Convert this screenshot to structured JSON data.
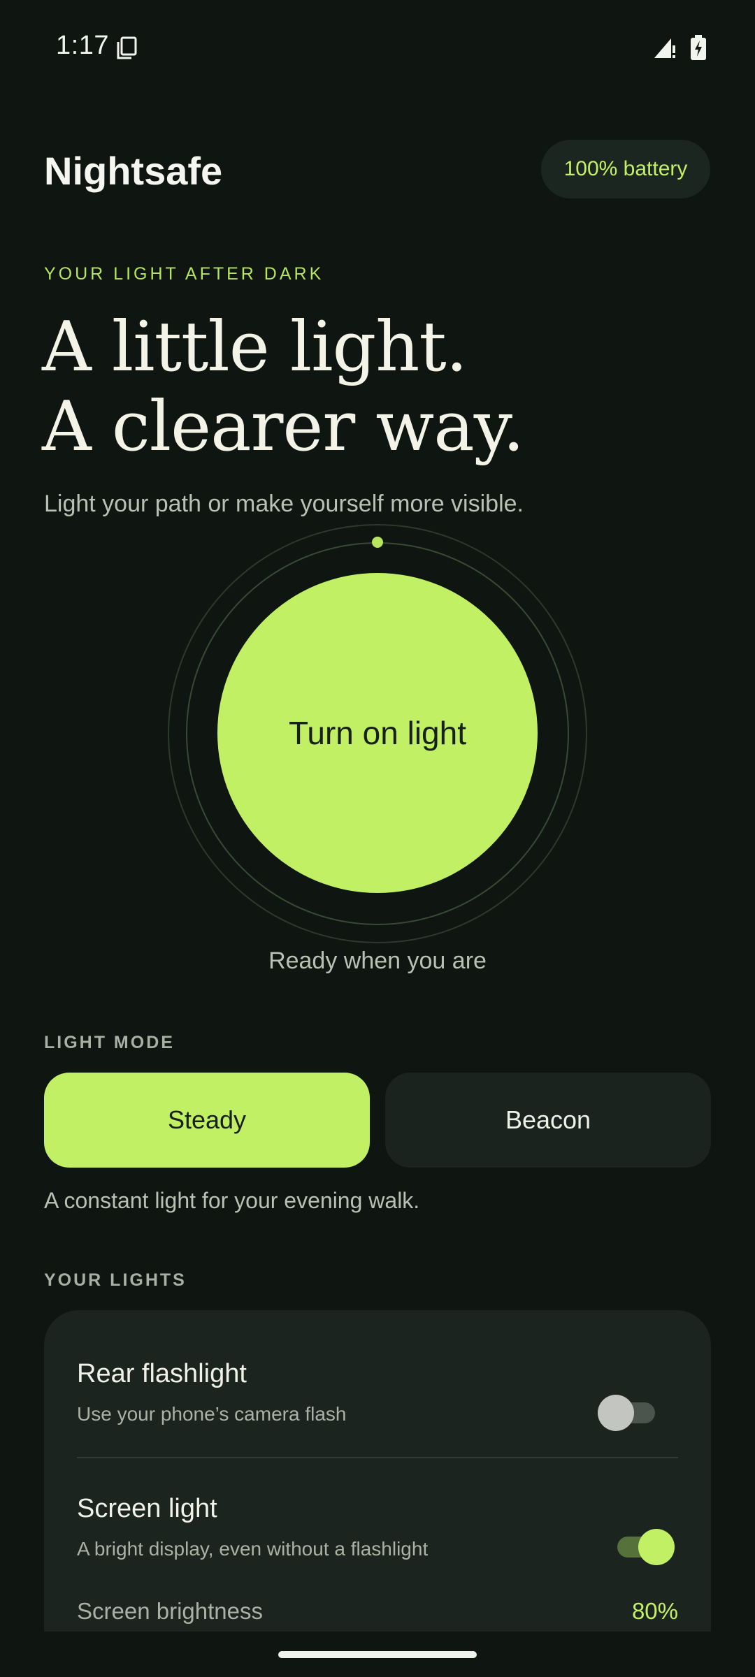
{
  "status": {
    "time": "1:17"
  },
  "app": {
    "title": "Nightsafe",
    "battery": "100% battery"
  },
  "hero": {
    "eyebrow": "YOUR LIGHT AFTER DARK",
    "headline_line1": "A little light.",
    "headline_line2": "A clearer way.",
    "subtitle": "Light your path or make yourself more visible."
  },
  "light": {
    "button_label": "Turn on light",
    "status": "Ready when you are"
  },
  "mode": {
    "section_label": "LIGHT MODE",
    "options": [
      "Steady",
      "Beacon"
    ],
    "selected": "Steady",
    "description": "A constant light for your evening walk."
  },
  "lights": {
    "section_label": "YOUR LIGHTS",
    "items": [
      {
        "title": "Rear flashlight",
        "subtitle": "Use your phone’s camera flash",
        "enabled": false
      },
      {
        "title": "Screen light",
        "subtitle": "A bright display, even without a flashlight",
        "enabled": true
      }
    ],
    "brightness_label": "Screen brightness",
    "brightness_value": "80%"
  },
  "colors": {
    "accent": "#c1f064",
    "background": "#0f1612",
    "card": "#1b241f"
  },
  "icons": [
    "screen-copy-icon",
    "signal-icon",
    "battery-charging-icon"
  ]
}
